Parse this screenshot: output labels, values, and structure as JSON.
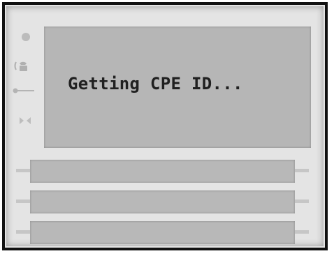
{
  "screen": {
    "message": "Getting CPE ID..."
  },
  "icons": [
    "power-icon",
    "phone-icon",
    "line-icon",
    "dsl-icon"
  ],
  "slots_count": 3,
  "colors": {
    "frame": "#111111",
    "panel": "#e4e4e4",
    "screen": "#b6b6b6",
    "text": "#202020",
    "slot": "#b8b8b8"
  }
}
